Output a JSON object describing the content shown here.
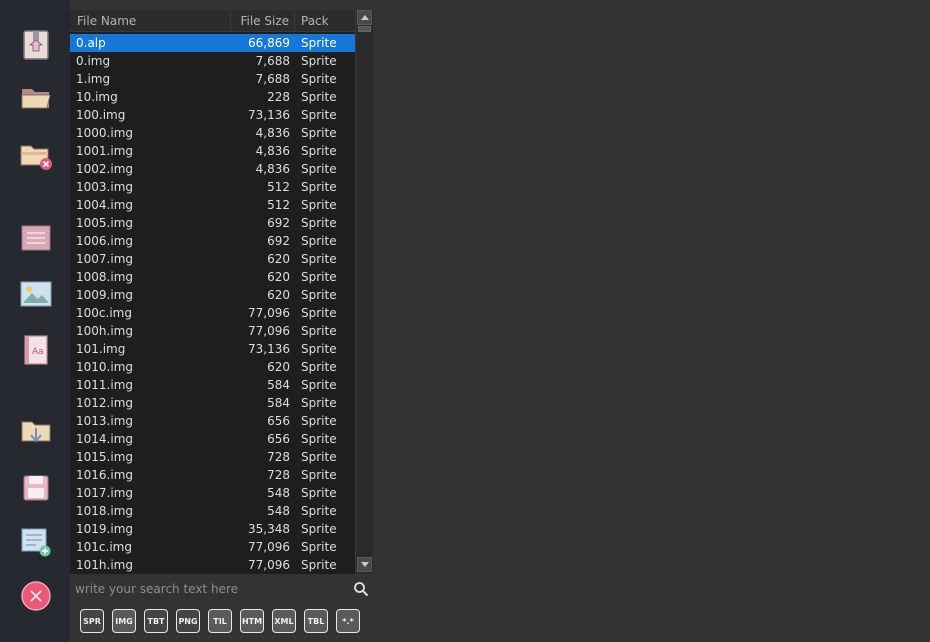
{
  "toolbar": {
    "buttons": [
      {
        "icon": "zip-archive-icon"
      },
      {
        "icon": "open-folder-icon"
      },
      {
        "icon": "close-folder-icon"
      },
      {
        "icon": "list-icon"
      },
      {
        "icon": "image-icon"
      },
      {
        "icon": "font-book-icon"
      },
      {
        "icon": "extract-folder-icon"
      },
      {
        "icon": "save-disk-icon"
      },
      {
        "icon": "add-note-icon"
      },
      {
        "icon": "close-circle-icon"
      }
    ]
  },
  "file_list": {
    "columns": {
      "name": "File Name",
      "size": "File Size",
      "pack": "Pack"
    },
    "selected_index": 0,
    "rows": [
      {
        "name": "0.alp",
        "size": "66,869",
        "pack": "Sprite"
      },
      {
        "name": "0.img",
        "size": "7,688",
        "pack": "Sprite"
      },
      {
        "name": "1.img",
        "size": "7,688",
        "pack": "Sprite"
      },
      {
        "name": "10.img",
        "size": "228",
        "pack": "Sprite"
      },
      {
        "name": "100.img",
        "size": "73,136",
        "pack": "Sprite"
      },
      {
        "name": "1000.img",
        "size": "4,836",
        "pack": "Sprite"
      },
      {
        "name": "1001.img",
        "size": "4,836",
        "pack": "Sprite"
      },
      {
        "name": "1002.img",
        "size": "4,836",
        "pack": "Sprite"
      },
      {
        "name": "1003.img",
        "size": "512",
        "pack": "Sprite"
      },
      {
        "name": "1004.img",
        "size": "512",
        "pack": "Sprite"
      },
      {
        "name": "1005.img",
        "size": "692",
        "pack": "Sprite"
      },
      {
        "name": "1006.img",
        "size": "692",
        "pack": "Sprite"
      },
      {
        "name": "1007.img",
        "size": "620",
        "pack": "Sprite"
      },
      {
        "name": "1008.img",
        "size": "620",
        "pack": "Sprite"
      },
      {
        "name": "1009.img",
        "size": "620",
        "pack": "Sprite"
      },
      {
        "name": "100c.img",
        "size": "77,096",
        "pack": "Sprite"
      },
      {
        "name": "100h.img",
        "size": "77,096",
        "pack": "Sprite"
      },
      {
        "name": "101.img",
        "size": "73,136",
        "pack": "Sprite"
      },
      {
        "name": "1010.img",
        "size": "620",
        "pack": "Sprite"
      },
      {
        "name": "1011.img",
        "size": "584",
        "pack": "Sprite"
      },
      {
        "name": "1012.img",
        "size": "584",
        "pack": "Sprite"
      },
      {
        "name": "1013.img",
        "size": "656",
        "pack": "Sprite"
      },
      {
        "name": "1014.img",
        "size": "656",
        "pack": "Sprite"
      },
      {
        "name": "1015.img",
        "size": "728",
        "pack": "Sprite"
      },
      {
        "name": "1016.img",
        "size": "728",
        "pack": "Sprite"
      },
      {
        "name": "1017.img",
        "size": "548",
        "pack": "Sprite"
      },
      {
        "name": "1018.img",
        "size": "548",
        "pack": "Sprite"
      },
      {
        "name": "1019.img",
        "size": "35,348",
        "pack": "Sprite"
      },
      {
        "name": "101c.img",
        "size": "77,096",
        "pack": "Sprite"
      },
      {
        "name": "101h.img",
        "size": "77,096",
        "pack": "Sprite"
      }
    ]
  },
  "search": {
    "placeholder": "write your search text here",
    "value": "",
    "icon": "search-icon"
  },
  "filters": [
    {
      "label": "SPR",
      "active": false
    },
    {
      "label": "IMG",
      "active": true
    },
    {
      "label": "TBT",
      "active": false
    },
    {
      "label": "PNG",
      "active": false
    },
    {
      "label": "TIL",
      "active": true
    },
    {
      "label": "HTM",
      "active": true
    },
    {
      "label": "XML",
      "active": true
    },
    {
      "label": "TBL",
      "active": true
    },
    {
      "label": "*.*",
      "active": true
    }
  ],
  "colors": {
    "selection": "#1577d6",
    "background": "#333333",
    "sidebar": "#262a30",
    "list_bg": "#1e1e1e"
  }
}
